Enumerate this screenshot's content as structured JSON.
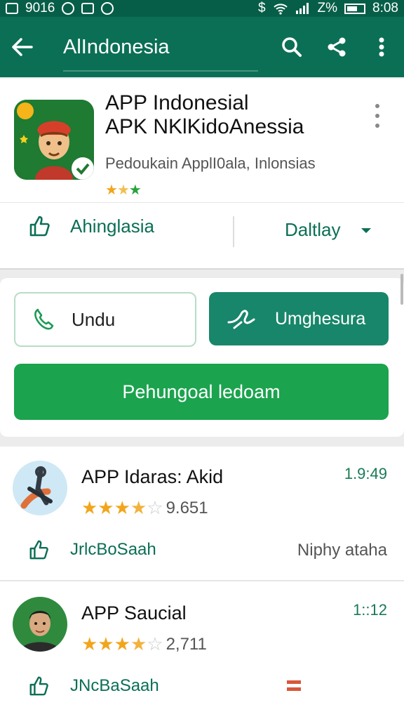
{
  "status_bar": {
    "left_text": "9016",
    "battery_text": "Z%",
    "time": "8:08"
  },
  "app_bar": {
    "title": "AlIndonesia",
    "icons": [
      "back-arrow-icon",
      "search-icon",
      "share-icon",
      "more-vert-icon"
    ]
  },
  "app_header": {
    "title_line1": "APP Indonesial",
    "title_line2": "APK NKlKidoAnessia",
    "developer": "Pedoukain ApplI0ala, Inlonsias",
    "rating_stars": 3,
    "like_label": "Ahinglasia",
    "dropdown_label": "Daltlay"
  },
  "actions": {
    "outline_button": "Undu",
    "filled_button": "Umghesura",
    "primary_button": "Pehungoal ledoam"
  },
  "list": [
    {
      "title": "APP Idaras: Akid",
      "rating": 3.5,
      "count": "9.651",
      "time": "1.9:49",
      "like_label": "JrlcBoSaah",
      "right_text": "Niphy ataha"
    },
    {
      "title": "APP Saucial",
      "rating": 3.5,
      "count": "2,711",
      "time": "1::12",
      "like_label": "JNcBaSaah",
      "right_text": ""
    }
  ],
  "colors": {
    "app_bar": "#0b6f55",
    "accent_green": "#1ba34e",
    "teal_button": "#17866a",
    "star": "#f2a51c"
  }
}
